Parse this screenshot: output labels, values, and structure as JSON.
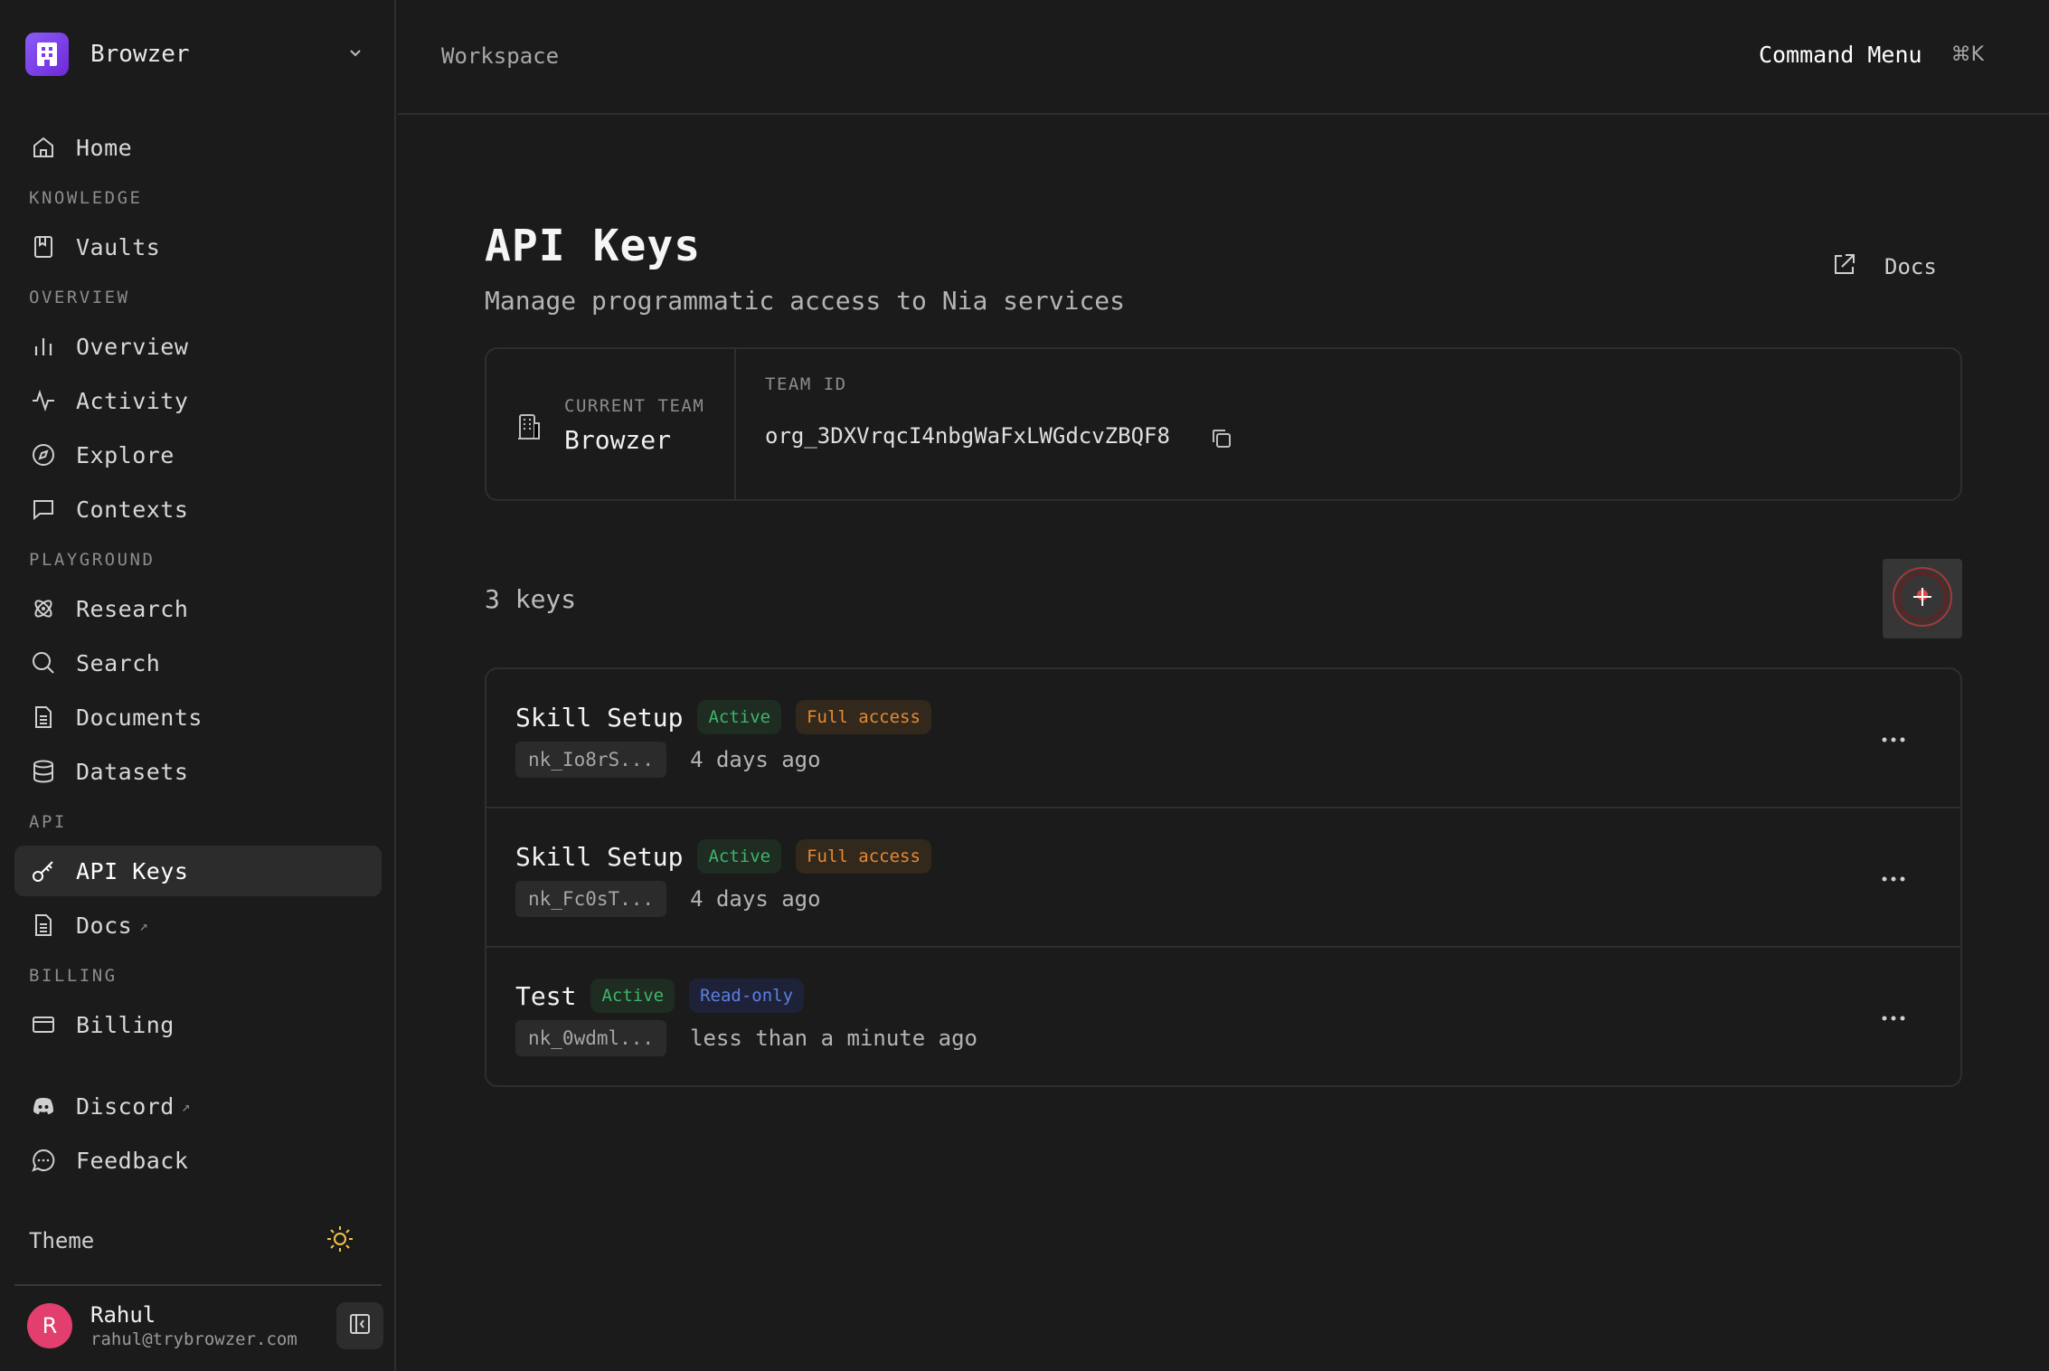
{
  "org": {
    "name": "Browzer"
  },
  "sidebar": {
    "home": "Home",
    "sections": {
      "knowledge": "KNOWLEDGE",
      "overview": "OVERVIEW",
      "playground": "PLAYGROUND",
      "api": "API",
      "billing": "BILLING"
    },
    "items": {
      "vaults": "Vaults",
      "overview": "Overview",
      "activity": "Activity",
      "explore": "Explore",
      "contexts": "Contexts",
      "research": "Research",
      "search": "Search",
      "documents": "Documents",
      "datasets": "Datasets",
      "api_keys": "API Keys",
      "docs": "Docs",
      "billing": "Billing",
      "discord": "Discord",
      "feedback": "Feedback"
    },
    "external_glyph": "↗",
    "theme_label": "Theme"
  },
  "user": {
    "initial": "R",
    "name": "Rahul",
    "email": "rahul@trybrowzer.com"
  },
  "header": {
    "breadcrumb": "Workspace",
    "command_menu": "Command Menu",
    "shortcut": "⌘K"
  },
  "page": {
    "title": "API Keys",
    "subtitle": "Manage programmatic access to Nia services",
    "docs_link": "Docs"
  },
  "team": {
    "current_team_label": "CURRENT TEAM",
    "current_team": "Browzer",
    "team_id_label": "TEAM ID",
    "team_id": "org_3DXVrqcI4nbgWaFxLWGdcvZBQF8"
  },
  "keys": {
    "count_label": "3 keys",
    "rows": [
      {
        "name": "Skill Setup",
        "status": "Active",
        "access": "Full access",
        "prefix": "nk_Io8rS...",
        "created": "4 days ago"
      },
      {
        "name": "Skill Setup",
        "status": "Active",
        "access": "Full access",
        "prefix": "nk_Fc0sT...",
        "created": "4 days ago"
      },
      {
        "name": "Test",
        "status": "Active",
        "access": "Read-only",
        "prefix": "nk_0wdml...",
        "created": "less than a minute ago"
      }
    ]
  },
  "colors": {
    "accent": "#8b5cf6",
    "active_green": "#3fb66b",
    "full_access_orange": "#e68a33",
    "read_only_blue": "#5b7fe0",
    "avatar": "#e23e6e"
  }
}
